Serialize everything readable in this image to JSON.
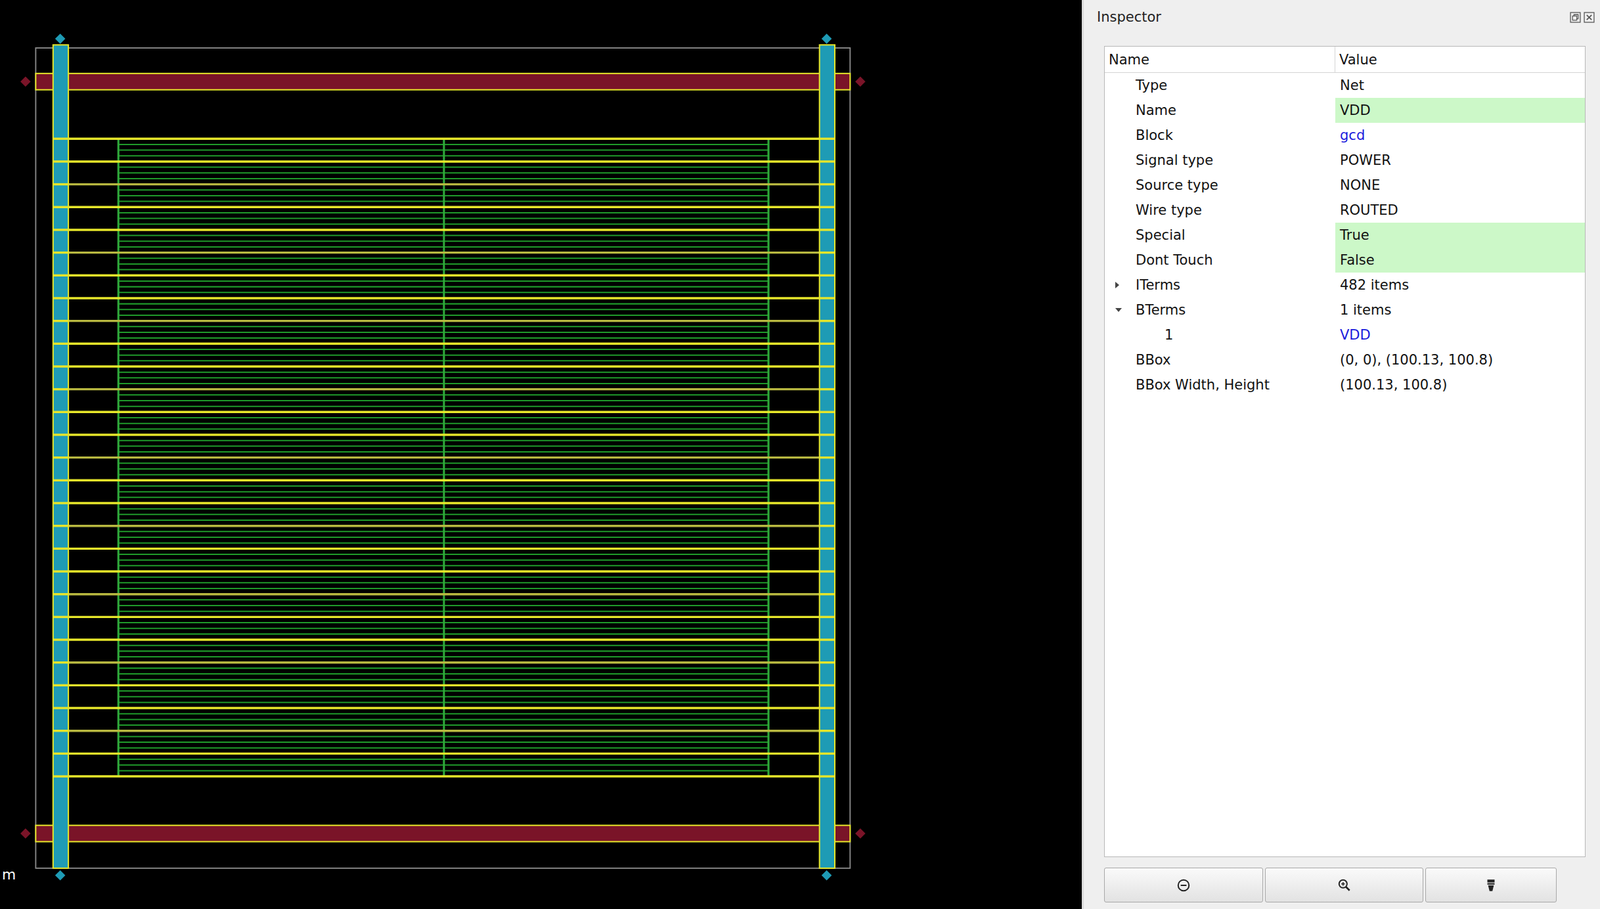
{
  "canvas": {
    "scale_label": "m"
  },
  "inspector": {
    "title": "Inspector",
    "columns": [
      "Name",
      "Value"
    ],
    "rows": [
      {
        "name": "Type",
        "value": "Net",
        "kind": "property",
        "highlighted": false,
        "link": false,
        "expanded": false,
        "children": []
      },
      {
        "name": "Name",
        "value": "VDD",
        "kind": "property",
        "highlighted": true,
        "link": false,
        "expanded": false,
        "children": []
      },
      {
        "name": "Block",
        "value": "gcd",
        "kind": "property",
        "highlighted": false,
        "link": true,
        "expanded": false,
        "children": []
      },
      {
        "name": "Signal type",
        "value": "POWER",
        "kind": "property",
        "highlighted": false,
        "link": false,
        "expanded": false,
        "children": []
      },
      {
        "name": "Source type",
        "value": "NONE",
        "kind": "property",
        "highlighted": false,
        "link": false,
        "expanded": false,
        "children": []
      },
      {
        "name": "Wire type",
        "value": "ROUTED",
        "kind": "property",
        "highlighted": false,
        "link": false,
        "expanded": false,
        "children": []
      },
      {
        "name": "Special",
        "value": "True",
        "kind": "property",
        "highlighted": true,
        "link": false,
        "expanded": false,
        "children": []
      },
      {
        "name": "Dont Touch",
        "value": "False",
        "kind": "property",
        "highlighted": true,
        "link": false,
        "expanded": false,
        "children": []
      },
      {
        "name": "ITerms",
        "value": "482 items",
        "kind": "group",
        "highlighted": false,
        "link": false,
        "expanded": false,
        "children": []
      },
      {
        "name": "BTerms",
        "value": "1 items",
        "kind": "group",
        "highlighted": false,
        "link": false,
        "expanded": true,
        "children": [
          {
            "name": "1",
            "value": "VDD",
            "link": true
          }
        ]
      },
      {
        "name": "BBox",
        "value": "(0, 0), (100.13, 100.8)",
        "kind": "property",
        "highlighted": false,
        "link": false,
        "expanded": false,
        "children": []
      },
      {
        "name": "BBox Width, Height",
        "value": "(100.13, 100.8)",
        "kind": "property",
        "highlighted": false,
        "link": false,
        "expanded": false,
        "children": []
      }
    ]
  }
}
